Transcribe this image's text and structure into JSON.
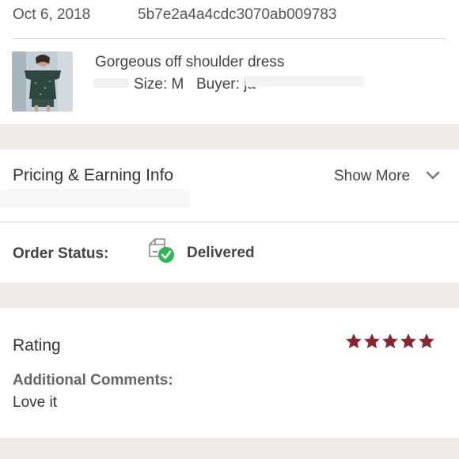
{
  "order": {
    "date": "Oct 6, 2018",
    "order_id": "5b7e2a4a4cdc3070ab009783"
  },
  "item": {
    "title": "Gorgeous off shoulder dress",
    "size_label": "Size: M",
    "buyer_label": "Buyer: ja"
  },
  "pricing": {
    "heading": "Pricing & Earning Info",
    "show_more": "Show More"
  },
  "status": {
    "label": "Order Status:",
    "value": "Delivered"
  },
  "rating": {
    "heading": "Rating",
    "stars": 5,
    "comments_label": "Additional Comments:",
    "comments_text": "Love it"
  },
  "colors": {
    "star": "#8b2331",
    "delivered_check": "#2fb551",
    "band": "#eeebe6"
  },
  "icons": {
    "show_more": "chevron-down-icon",
    "status": "package-delivered-icon",
    "rating": "star-icon"
  }
}
